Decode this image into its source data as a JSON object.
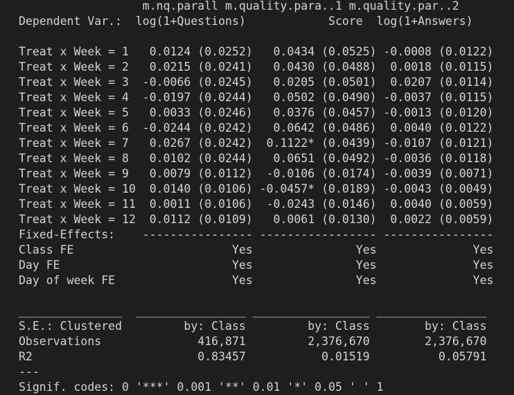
{
  "console": {
    "lines": [
      "                  m.nq.parall m.quality.para..1 m.quality.par..2",
      "Dependent Var.:  log(1+Questions)            Score  log(1+Answers)",
      "",
      "Treat x Week = 1   0.0124 (0.0252)   0.0434 (0.0525) -0.0008 (0.0122)",
      "Treat x Week = 2   0.0215 (0.0241)   0.0430 (0.0488)  0.0018 (0.0115)",
      "Treat x Week = 3  -0.0066 (0.0245)   0.0205 (0.0501)  0.0207 (0.0114)",
      "Treat x Week = 4  -0.0197 (0.0244)   0.0502 (0.0490) -0.0037 (0.0115)",
      "Treat x Week = 5   0.0033 (0.0246)   0.0376 (0.0457) -0.0013 (0.0120)",
      "Treat x Week = 6  -0.0244 (0.0242)   0.0642 (0.0486)  0.0040 (0.0122)",
      "Treat x Week = 7   0.0267 (0.0242)  0.1122* (0.0439) -0.0107 (0.0121)",
      "Treat x Week = 8   0.0102 (0.0244)   0.0651 (0.0492) -0.0036 (0.0118)",
      "Treat x Week = 9   0.0079 (0.0112)  -0.0106 (0.0174) -0.0039 (0.0071)",
      "Treat x Week = 10  0.0140 (0.0106) -0.0457* (0.0189) -0.0043 (0.0049)",
      "Treat x Week = 11  0.0011 (0.0106)  -0.0243 (0.0146)  0.0040 (0.0059)",
      "Treat x Week = 12  0.0112 (0.0109)   0.0061 (0.0130)  0.0022 (0.0059)",
      "Fixed-Effects:    ---------------- ----------------- ----------------",
      "Class FE                       Yes               Yes              Yes",
      "Day FE                         Yes               Yes              Yes",
      "Day of week FE                 Yes               Yes              Yes",
      "",
      "_______________  ________________ _________________ ________________",
      "S.E.: Clustered         by: Class         by: Class        by: Class",
      "Observations              416,871         2,376,670        2,376,670",
      "R2                        0.83457           0.01519          0.05791",
      "---",
      "Signif. codes: 0 '***' 0.001 '**' 0.01 '*' 0.05 ' ' 1"
    ]
  }
}
